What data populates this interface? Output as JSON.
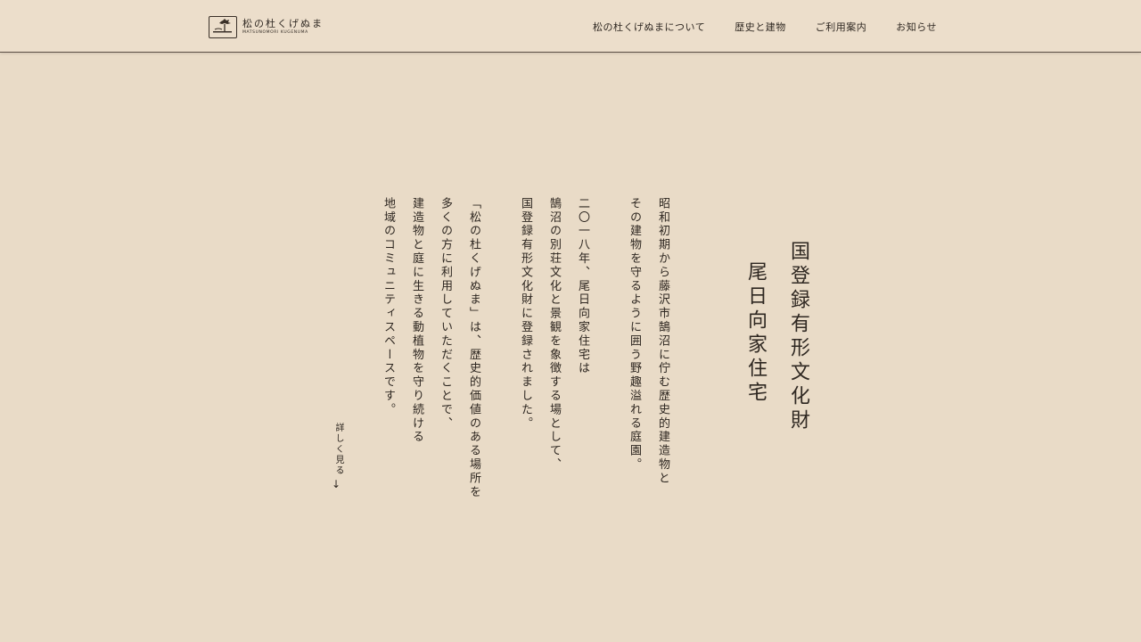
{
  "header": {
    "logo_jp": "松の杜くげぬま",
    "logo_en": "MATSUNOMORI KUGENUMA",
    "nav": [
      "松の杜くげぬまについて",
      "歴史と建物",
      "ご利用案内",
      "お知らせ"
    ]
  },
  "hero": {
    "title_lines": [
      "国登録有形文化財",
      "尾日向家住宅"
    ],
    "paragraph1": [
      "昭和初期から藤沢市鵠沼に佇む歴史的建造物と",
      "その建物を守るように囲う野趣溢れる庭園。"
    ],
    "paragraph2": [
      "二〇一八年、尾日向家住宅は",
      "鵠沼の別荘文化と景観を象徴する場として、",
      "国登録有形文化財に登録されました。"
    ],
    "paragraph3": [
      "「松の杜くげぬま」は、歴史的価値のある場所を",
      "多くの方に利用していただくことで、",
      "建造物と庭に生きる動植物を守り続ける",
      "地域のコミュニティスペースです。"
    ],
    "more_label": "詳しく見る",
    "more_arrow": "↓"
  }
}
